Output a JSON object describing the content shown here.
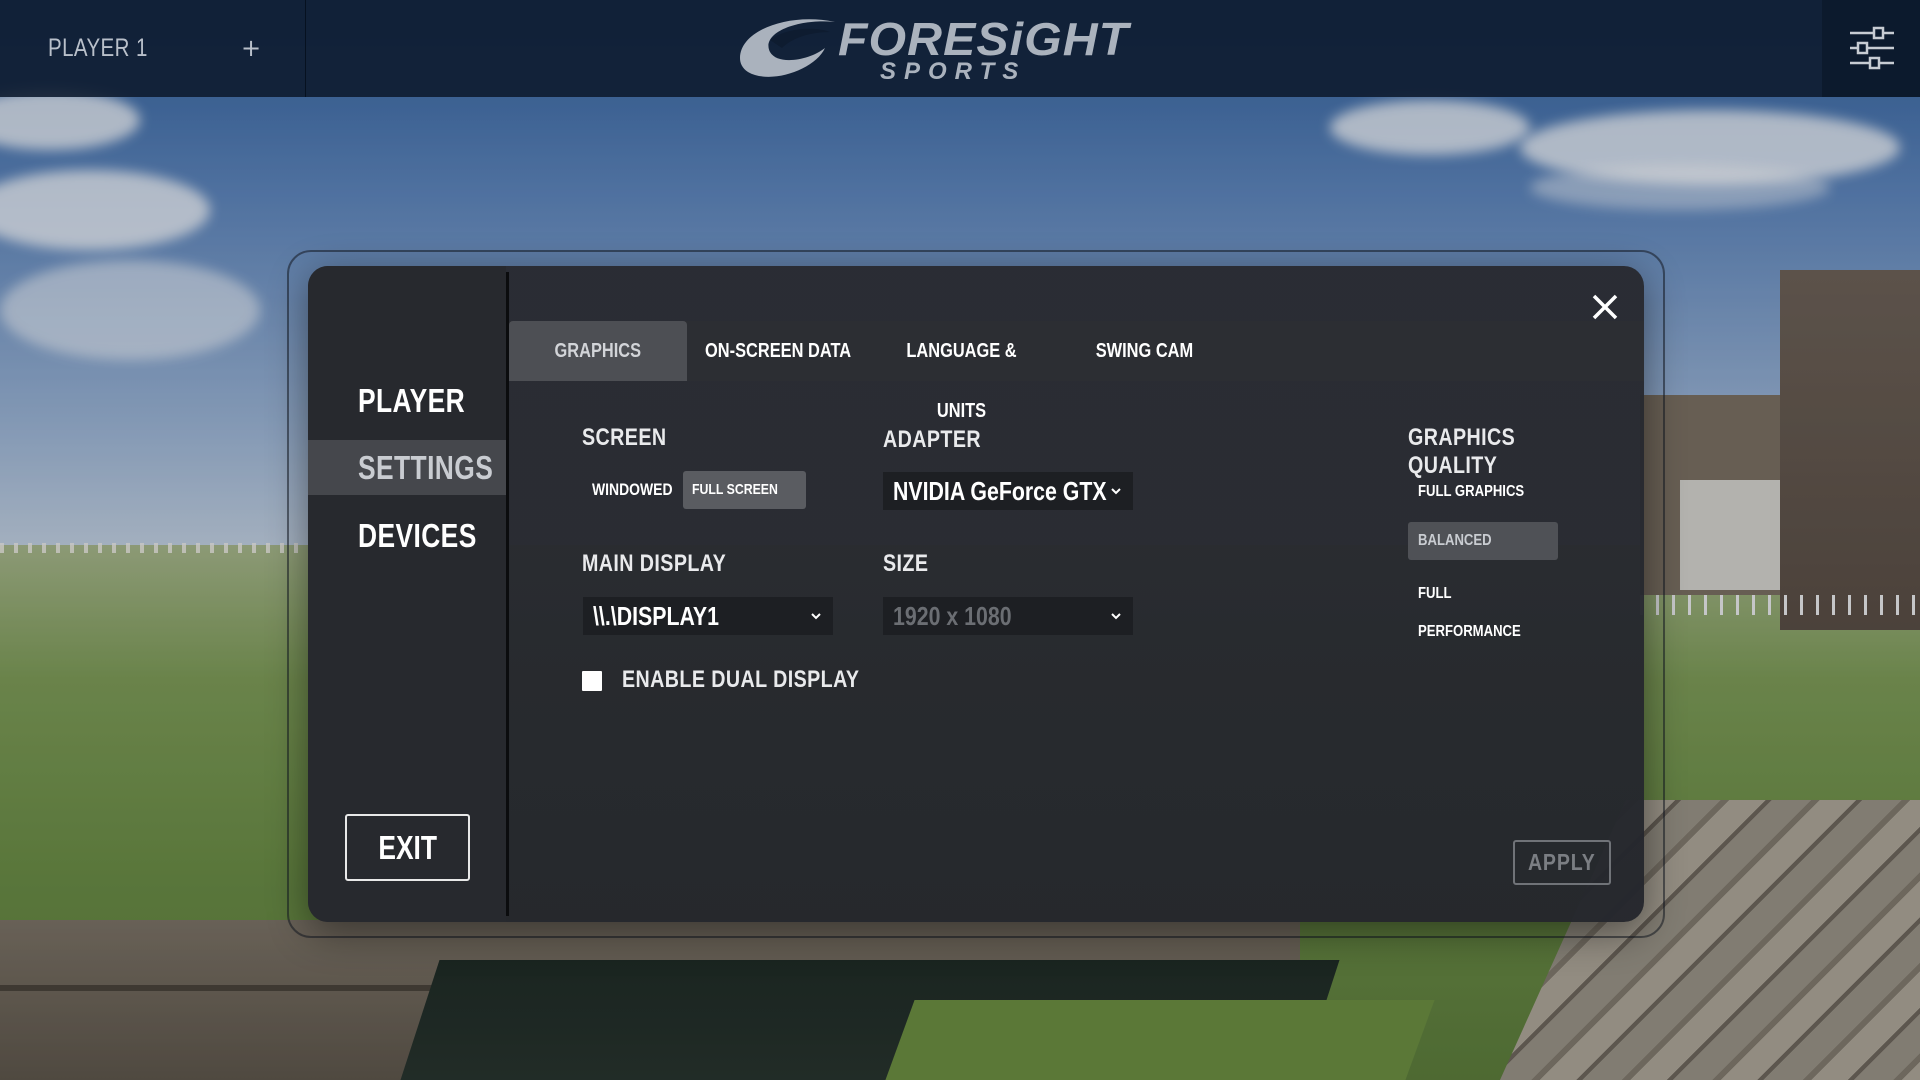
{
  "topbar": {
    "player_label": "PLAYER 1",
    "add_player_symbol": "+",
    "logo_word": "FORESiGHT",
    "logo_sub": "SPORTS",
    "menu_icon": "sliders-icon"
  },
  "sidebar": {
    "items": [
      {
        "label": "PLAYER",
        "active": false
      },
      {
        "label": "SETTINGS",
        "active": true
      },
      {
        "label": "DEVICES",
        "active": false
      }
    ],
    "exit_label": "EXIT"
  },
  "tabs": [
    {
      "label": "GRAPHICS",
      "active": true
    },
    {
      "label": "ON-SCREEN DATA",
      "active": false
    },
    {
      "label": "LANGUAGE & UNITS",
      "active": false
    },
    {
      "label": "SWING CAM",
      "active": false
    }
  ],
  "graphics": {
    "screen": {
      "label": "SCREEN",
      "options": [
        "WINDOWED",
        "FULL SCREEN"
      ],
      "selected": "FULL SCREEN"
    },
    "adapter": {
      "label": "ADAPTER",
      "value": "NVIDIA GeForce GTX"
    },
    "main_display": {
      "label": "MAIN DISPLAY",
      "value": "\\\\.\\DISPLAY1"
    },
    "size": {
      "label": "SIZE",
      "value": "1920 x 1080",
      "disabled": true
    },
    "dual_display": {
      "label": "ENABLE DUAL DISPLAY",
      "checked": false
    },
    "quality": {
      "label": "GRAPHICS QUALITY",
      "options": [
        "FULL GRAPHICS",
        "BALANCED",
        "FULL PERFORMANCE"
      ],
      "selected": "BALANCED"
    }
  },
  "apply_label": "APPLY",
  "colors": {
    "topbar": "#0e1c30",
    "dialog": "#282a30",
    "active_item": "#45474c"
  }
}
